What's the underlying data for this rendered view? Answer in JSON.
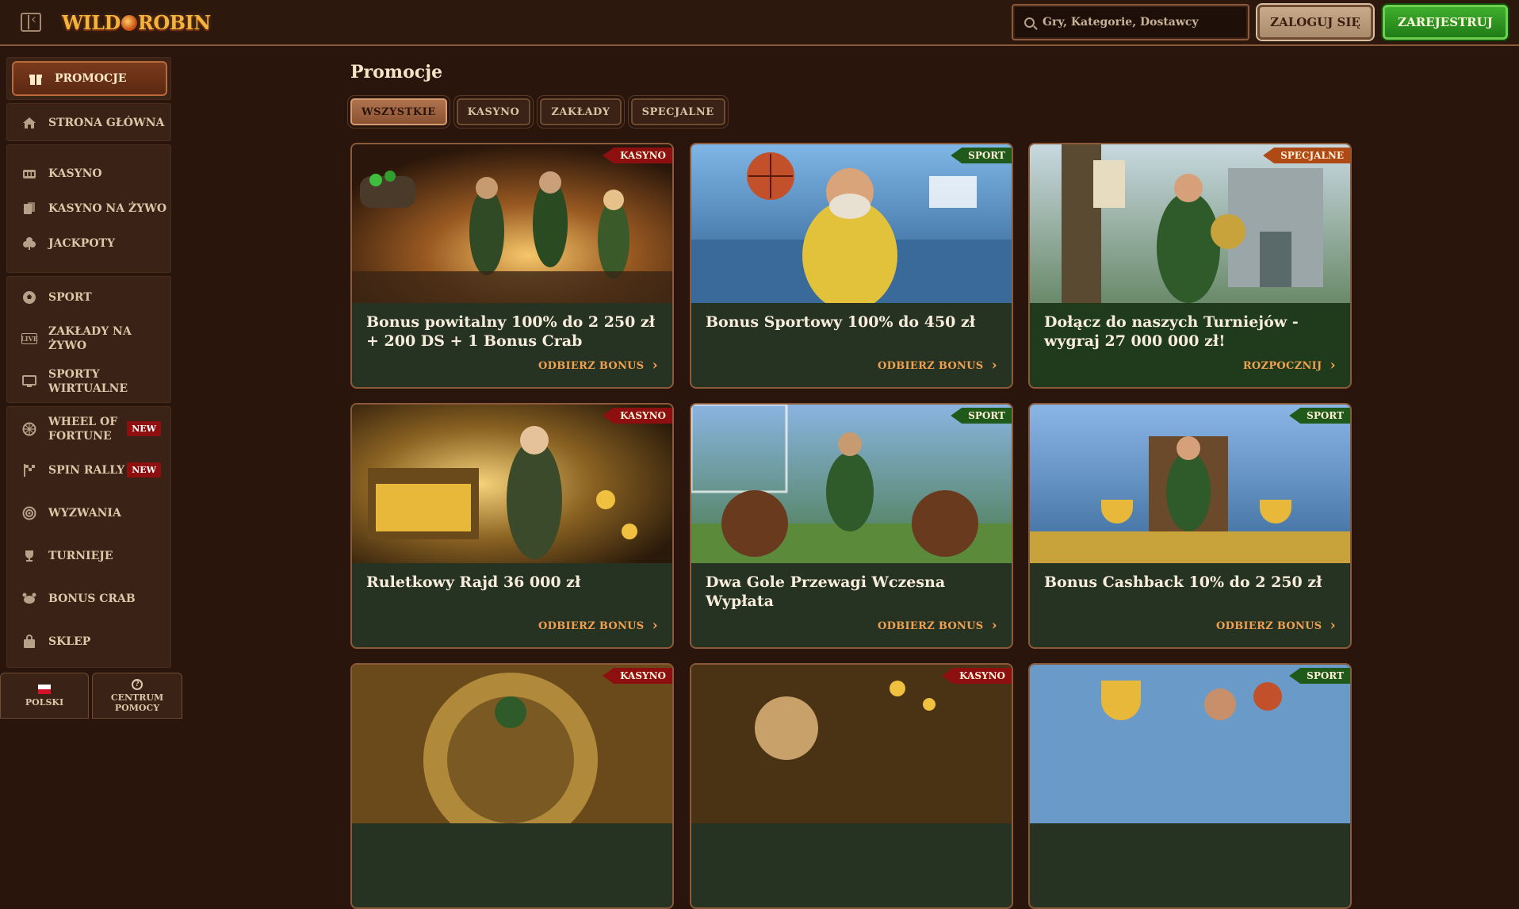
{
  "header": {
    "logo": {
      "part1": "WILD",
      "part2": "ROBIN"
    },
    "search_placeholder": "Gry, Kategorie, Dostawcy",
    "login_label": "ZALOGUJ SIĘ",
    "register_label": "ZAREJESTRUJ"
  },
  "sidebar": {
    "items": [
      {
        "label": "PROMOCJE",
        "icon": "gift-icon"
      },
      {
        "label": "STRONA GŁÓWNA",
        "icon": "home-icon"
      },
      {
        "label": "KASYNO",
        "icon": "slot-machine-icon"
      },
      {
        "label": "KASYNO NA ŻYWO",
        "icon": "cards-icon"
      },
      {
        "label": "JACKPOTY",
        "icon": "clover-icon"
      },
      {
        "label": "SPORT",
        "icon": "soccer-ball-icon"
      },
      {
        "label": "ZAKŁADY NA ŻYWO",
        "icon": "live-icon"
      },
      {
        "label": "SPORTY WIRTUALNE",
        "icon": "monitor-icon"
      },
      {
        "label": "WHEEL OF FORTUNE",
        "icon": "wheel-icon",
        "badge": "NEW"
      },
      {
        "label": "SPIN RALLY",
        "icon": "checkered-flag-icon",
        "badge": "NEW"
      },
      {
        "label": "WYZWANIA",
        "icon": "target-icon"
      },
      {
        "label": "TURNIEJE",
        "icon": "trophy-icon"
      },
      {
        "label": "BONUS CRAB",
        "icon": "crab-icon"
      },
      {
        "label": "SKLEP",
        "icon": "shopping-bag-icon"
      }
    ],
    "language_label": "POLSKI",
    "help_label": "CENTRUM POMOCY"
  },
  "main": {
    "title": "Promocje",
    "filters": [
      "WSZYSTKIE",
      "KASYNO",
      "ZAKŁADY",
      "SPECJALNE"
    ],
    "active_filter": "WSZYSTKIE",
    "cards": [
      {
        "tag": "KASYNO",
        "title": "Bonus powitalny 100% do 2 250 zł + 200 DS + 1 Bonus Crab",
        "cta": "ODBIERZ BONUS"
      },
      {
        "tag": "SPORT",
        "title": "Bonus Sportowy 100% do 450 zł",
        "cta": "ODBIERZ BONUS"
      },
      {
        "tag": "SPECJALNE",
        "title": "Dołącz do naszych Turniejów - wygraj 27 000 000 zł!",
        "cta": "ROZPOCZNIJ"
      },
      {
        "tag": "KASYNO",
        "title": "Ruletkowy Rajd 36 000 zł",
        "cta": "ODBIERZ BONUS"
      },
      {
        "tag": "SPORT",
        "title": "Dwa Gole Przewagi Wczesna Wypłata",
        "cta": "ODBIERZ BONUS"
      },
      {
        "tag": "SPORT",
        "title": "Bonus Cashback 10% do 2 250 zł",
        "cta": "ODBIERZ BONUS"
      },
      {
        "tag": "KASYNO",
        "title": "",
        "cta": ""
      },
      {
        "tag": "KASYNO",
        "title": "",
        "cta": ""
      },
      {
        "tag": "SPORT",
        "title": "",
        "cta": ""
      }
    ]
  }
}
